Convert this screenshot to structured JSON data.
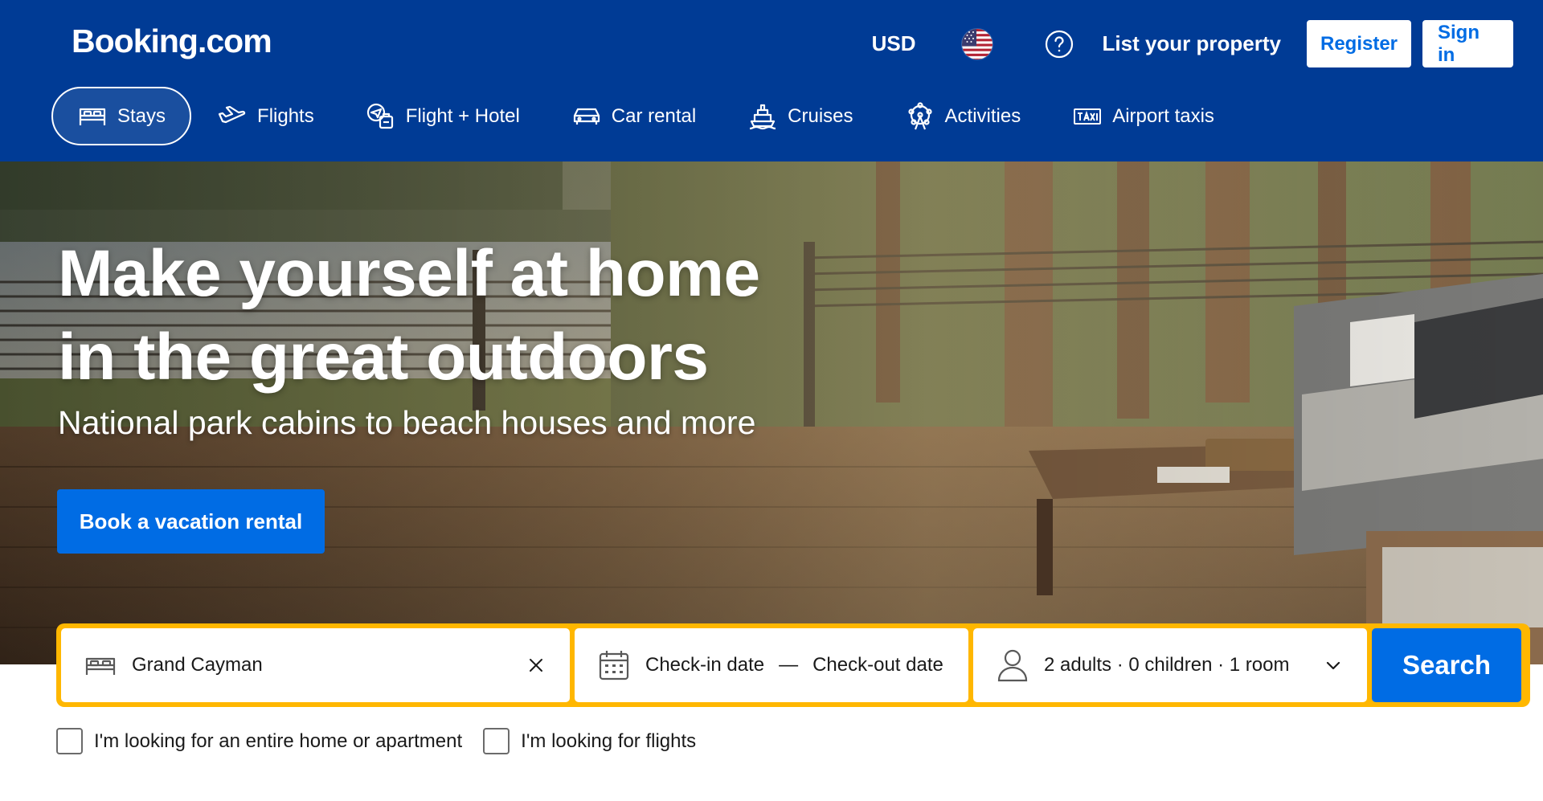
{
  "brand": {
    "logo_text": "Booking.com",
    "color": "#003b95",
    "accent": "#006ce4",
    "highlight": "#ffb700"
  },
  "header": {
    "currency": "USD",
    "flag_icon": "us-flag-icon",
    "help_icon": "question-circle-icon",
    "list_property": "List your property",
    "register": "Register",
    "sign_in": "Sign in"
  },
  "nav": {
    "items": [
      {
        "label": "Stays",
        "icon": "bed-icon",
        "active": true
      },
      {
        "label": "Flights",
        "icon": "plane-icon",
        "active": false
      },
      {
        "label": "Flight + Hotel",
        "icon": "flight-hotel-icon",
        "active": false
      },
      {
        "label": "Car rental",
        "icon": "car-icon",
        "active": false
      },
      {
        "label": "Cruises",
        "icon": "ship-icon",
        "active": false
      },
      {
        "label": "Activities",
        "icon": "ferris-wheel-icon",
        "active": false
      },
      {
        "label": "Airport taxis",
        "icon": "taxi-icon",
        "active": false
      }
    ]
  },
  "hero": {
    "title_line1": "Make yourself at home",
    "title_line2": "in the great outdoors",
    "subtitle": "National park cabins to beach houses and more",
    "cta": "Book a vacation rental"
  },
  "search": {
    "destination": "Grand Cayman",
    "check_in": "Check-in date",
    "separator": "—",
    "check_out": "Check-out date",
    "guests": "2 adults · 0 children · 1 room",
    "button": "Search"
  },
  "options": {
    "entire_home": "I'm looking for an entire home or apartment",
    "flights": "I'm looking for flights"
  }
}
